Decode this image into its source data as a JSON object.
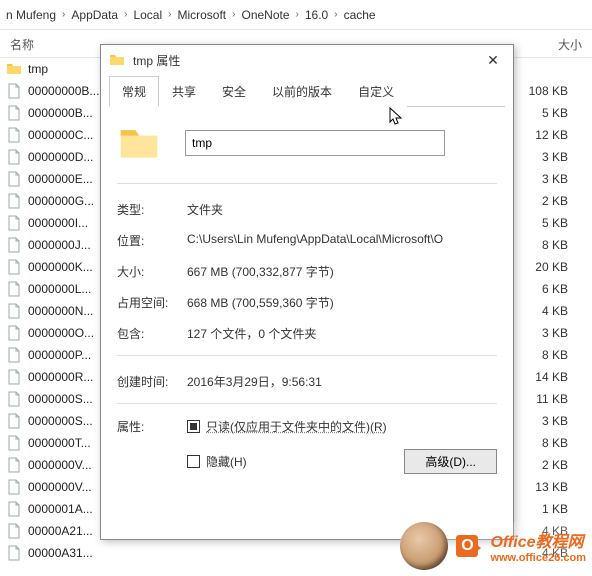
{
  "breadcrumb": [
    "n Mufeng",
    "AppData",
    "Local",
    "Microsoft",
    "OneNote",
    "16.0",
    "cache"
  ],
  "columns": {
    "name": "名称",
    "size": "大小"
  },
  "files": [
    {
      "name": "tmp",
      "type": "folder",
      "size": ""
    },
    {
      "name": "00000000B...",
      "type": "file",
      "size": "108 KB"
    },
    {
      "name": "0000000B...",
      "type": "file",
      "size": "5 KB"
    },
    {
      "name": "0000000C...",
      "type": "file",
      "size": "12 KB"
    },
    {
      "name": "0000000D...",
      "type": "file",
      "size": "3 KB"
    },
    {
      "name": "0000000E...",
      "type": "file",
      "size": "3 KB"
    },
    {
      "name": "0000000G...",
      "type": "file",
      "size": "2 KB"
    },
    {
      "name": "0000000I...",
      "type": "file",
      "size": "5 KB"
    },
    {
      "name": "0000000J...",
      "type": "file",
      "size": "8 KB"
    },
    {
      "name": "0000000K...",
      "type": "file",
      "size": "20 KB"
    },
    {
      "name": "0000000L...",
      "type": "file",
      "size": "6 KB"
    },
    {
      "name": "0000000N...",
      "type": "file",
      "size": "4 KB"
    },
    {
      "name": "0000000O...",
      "type": "file",
      "size": "3 KB"
    },
    {
      "name": "0000000P...",
      "type": "file",
      "size": "8 KB"
    },
    {
      "name": "0000000R...",
      "type": "file",
      "size": "14 KB"
    },
    {
      "name": "0000000S...",
      "type": "file",
      "size": "11 KB"
    },
    {
      "name": "0000000S...",
      "type": "file",
      "size": "3 KB"
    },
    {
      "name": "0000000T...",
      "type": "file",
      "size": "8 KB"
    },
    {
      "name": "0000000V...",
      "type": "file",
      "size": "2 KB"
    },
    {
      "name": "0000000V...",
      "type": "file",
      "size": "13 KB"
    },
    {
      "name": "0000001A...",
      "type": "file",
      "size": "1 KB"
    },
    {
      "name": "00000A21...",
      "type": "file",
      "size": "4 KB"
    },
    {
      "name": "00000A31...",
      "type": "file",
      "size": "4 KB"
    }
  ],
  "dialog": {
    "title": "tmp 属性",
    "tabs": [
      "常规",
      "共享",
      "安全",
      "以前的版本",
      "自定义"
    ],
    "name_value": "tmp",
    "props": {
      "type": {
        "label": "类型:",
        "value": "文件夹"
      },
      "location": {
        "label": "位置:",
        "value": "C:\\Users\\Lin Mufeng\\AppData\\Local\\Microsoft\\O"
      },
      "size": {
        "label": "大小:",
        "value": "667 MB (700,332,877 字节)"
      },
      "sizeondisk": {
        "label": "占用空间:",
        "value": "668 MB (700,559,360 字节)"
      },
      "contains": {
        "label": "包含:",
        "value": "127 个文件，0 个文件夹"
      },
      "created": {
        "label": "创建时间:",
        "value": "2016年3月29日，9:56:31"
      },
      "attr": {
        "label": "属性:"
      }
    },
    "readonly": "只读(仅应用于文件夹中的文件)(R)",
    "hidden": "隐藏(H)",
    "advanced": "高级(D)..."
  },
  "watermark": {
    "line1": "Office教程网",
    "line2": "www.office26.com"
  }
}
